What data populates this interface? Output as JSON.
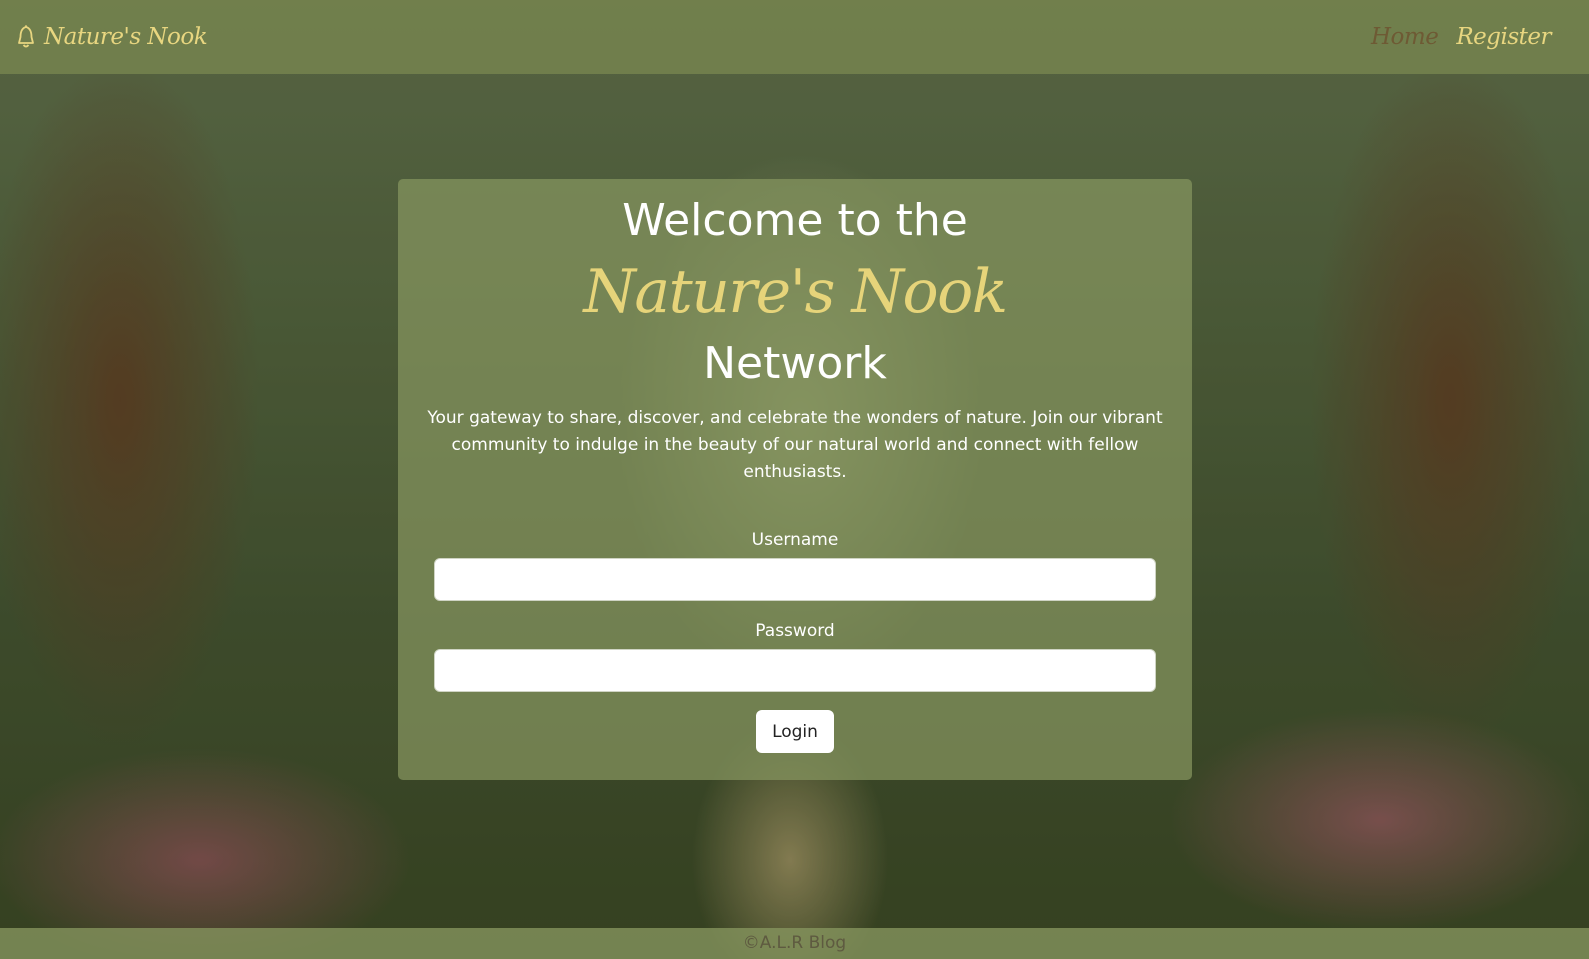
{
  "header": {
    "brand_name": "Nature's Nook",
    "brand_icon": "bell-icon",
    "nav": {
      "home": "Home",
      "register": "Register"
    }
  },
  "hero": {
    "line1": "Welcome to the",
    "brand": "Nature's Nook",
    "line3": "Network",
    "tagline": "Your gateway to share, discover, and celebrate the wonders of nature. Join our vibrant community to indulge in the beauty of our natural world and connect with fellow enthusiasts."
  },
  "form": {
    "username_label": "Username",
    "username_value": "",
    "password_label": "Password",
    "password_value": "",
    "login_label": "Login"
  },
  "footer": {
    "text": "©A.L.R Blog"
  },
  "colors": {
    "accent": "#e6d47a",
    "home_link": "#6e5a34"
  }
}
